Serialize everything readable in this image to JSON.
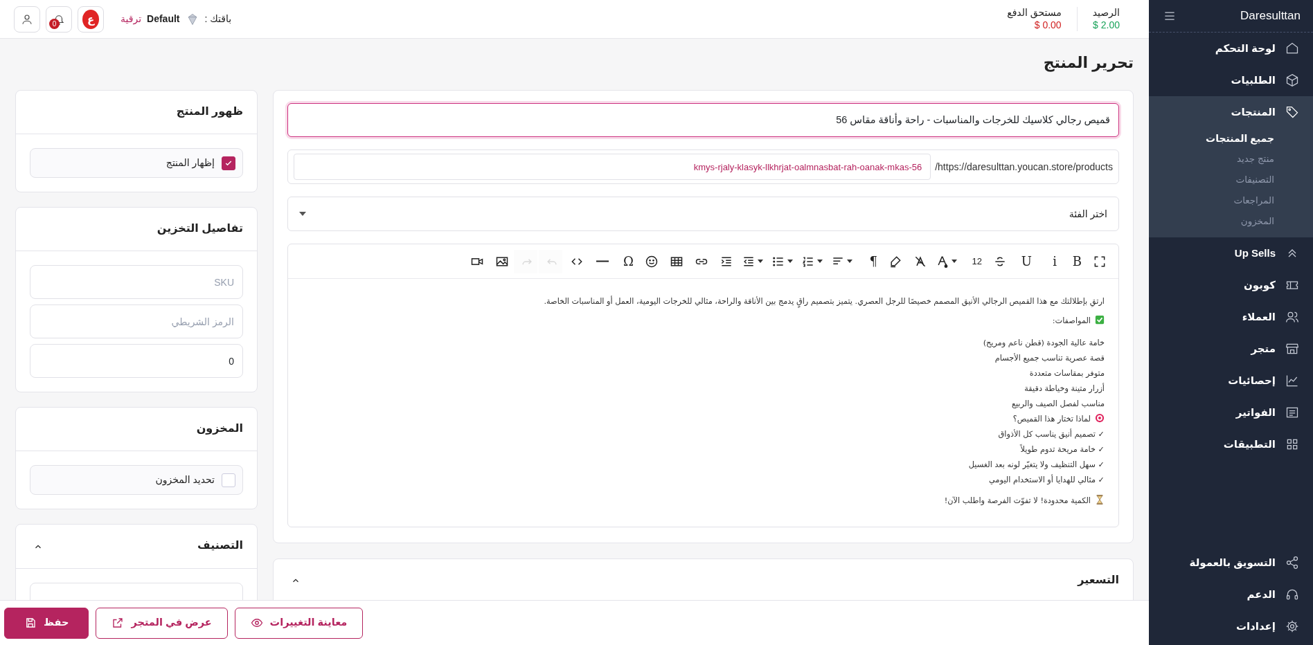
{
  "sidebar": {
    "brand": "Daresulttan",
    "items": [
      {
        "label": "لوحة التحكم",
        "selected": false
      },
      {
        "label": "الطلبيات",
        "selected": false
      },
      {
        "label": "المنتجات",
        "selected": true,
        "expanded": true,
        "children": [
          {
            "label": "جميع المنتجات",
            "selected": true
          },
          {
            "label": "منتج جديد",
            "selected": false
          },
          {
            "label": "التصنيفات",
            "selected": false
          },
          {
            "label": "المراجعات",
            "selected": false
          },
          {
            "label": "المخزون",
            "selected": false
          }
        ]
      },
      {
        "label": "Up Sells",
        "selected": false
      },
      {
        "label": "كوبون",
        "selected": false
      },
      {
        "label": "العملاء",
        "selected": false
      },
      {
        "label": "متجر",
        "selected": false
      },
      {
        "label": "إحصائيات",
        "selected": false
      },
      {
        "label": "الفواتير",
        "selected": false
      },
      {
        "label": "التطبيقات",
        "selected": false
      }
    ],
    "bottom_items": [
      {
        "label": "التسويق بالعمولة",
        "selected": false
      },
      {
        "label": "الدعم",
        "selected": false
      },
      {
        "label": "إعدادات",
        "selected": false
      }
    ]
  },
  "topbar": {
    "balance_label": "الرصيد",
    "balance": "2.00 $",
    "due_label": "مستحق الدفع",
    "due": "0.00 $",
    "plan_label": "باقتك :",
    "plan": "Default",
    "upgrade": "ترقية",
    "avatar_letter": "ع",
    "notification_count": "0"
  },
  "page_title": "تحرير المنتج",
  "product": {
    "name": "قميص رجالي كلاسيك للخرجات والمناسبات - راحة وأناقة مقاس 56",
    "url_prefix": "https://daresulttan.youcan.store/products/",
    "slug": "kmys-rjaly-klasyk-llkhrjat-oalmnasbat-rah-oanak-mkas-56",
    "category_placeholder": "اختر الفئة",
    "toolbar": [
      {
        "kind": "fullscreen",
        "disabled": false
      },
      {
        "kind": "glyph",
        "label": "B",
        "disabled": false
      },
      {
        "kind": "glyph",
        "label": "i",
        "disabled": false
      },
      {
        "kind": "glyph",
        "label": "U",
        "disabled": false
      },
      {
        "kind": "strike",
        "disabled": false
      },
      {
        "kind": "size",
        "label": "12",
        "disabled": false
      },
      {
        "kind": "font-color",
        "dropdown": true,
        "disabled": false
      },
      {
        "kind": "clear-format",
        "disabled": false
      },
      {
        "kind": "highlight",
        "disabled": false
      },
      {
        "kind": "glyph",
        "label": "¶",
        "disabled": false
      },
      {
        "kind": "align",
        "dropdown": true,
        "disabled": false
      },
      {
        "kind": "ordered-list",
        "dropdown": true,
        "disabled": false
      },
      {
        "kind": "bullet-list",
        "dropdown": true,
        "disabled": false
      },
      {
        "kind": "outdent",
        "dropdown": true,
        "disabled": false
      },
      {
        "kind": "indent",
        "disabled": false
      },
      {
        "kind": "link",
        "disabled": false
      },
      {
        "kind": "table",
        "disabled": false
      },
      {
        "kind": "emoji",
        "disabled": false
      },
      {
        "kind": "glyph",
        "label": "Ω",
        "disabled": false
      },
      {
        "kind": "rule",
        "disabled": false
      },
      {
        "kind": "code",
        "disabled": false
      },
      {
        "kind": "undo",
        "disabled": true
      },
      {
        "kind": "redo",
        "disabled": true
      },
      {
        "kind": "image",
        "disabled": false
      },
      {
        "kind": "video",
        "disabled": false
      }
    ],
    "description": [
      {
        "kind": "paragraph",
        "text": "ارتقِ بإطلالتك مع هذا القميص الرجالي الأنيق المصمم خصيصًا للرجل العصري. يتميز بتصميم راقٍ يدمج بين الأناقة والراحة، مثالي للخرجات اليومية، العمل أو المناسبات الخاصة."
      },
      {
        "kind": "check",
        "text": "المواصفات:"
      },
      {
        "kind": "line",
        "text": "خامة عالية الجودة (قطن ناعم ومريح)"
      },
      {
        "kind": "line",
        "text": "قصة عصرية تناسب جميع الأجسام"
      },
      {
        "kind": "line",
        "text": "متوفر بمقاسات متعددة"
      },
      {
        "kind": "line",
        "text": "أزرار متينة وخياطة دقيقة"
      },
      {
        "kind": "line",
        "text": "مناسب لفصل الصيف والربيع"
      },
      {
        "kind": "target",
        "text": "لماذا تختار هذا القميص؟"
      },
      {
        "kind": "line",
        "text": "✓ تصميم أنيق يناسب كل الأذواق"
      },
      {
        "kind": "line",
        "text": "✓ خامة مريحة تدوم طويلاً"
      },
      {
        "kind": "line",
        "text": "✓ سهل التنظيف ولا يتغيّر لونه بعد الغسيل"
      },
      {
        "kind": "line",
        "text": "✓ مثالي للهدايا أو الاستخدام اليومي"
      },
      {
        "kind": "hourglass",
        "text": "الكمية محدودة! لا تفوّت الفرصة واطلب الآن!"
      }
    ]
  },
  "pricing": {
    "title": "التسعير",
    "expanded": true
  },
  "visibility": {
    "title": "ظهور المنتج",
    "option": {
      "label": "إظهار المنتج",
      "checked": true
    }
  },
  "storage": {
    "title": "تفاصيل التخزين",
    "fields": [
      {
        "placeholder": "SKU"
      },
      {
        "placeholder": "الرمز الشريطي"
      },
      {
        "value": "0"
      }
    ]
  },
  "inventory": {
    "title": "المخزون",
    "option": {
      "label": "تحديد المخزون",
      "checked": false
    }
  },
  "classification": {
    "title": "التصنيف",
    "expanded": true
  },
  "actions": [
    {
      "kind": "preview",
      "label": "معاينة التغييرات"
    },
    {
      "kind": "view",
      "label": "عرض في المتجر"
    },
    {
      "kind": "save",
      "label": "حفظ"
    }
  ]
}
